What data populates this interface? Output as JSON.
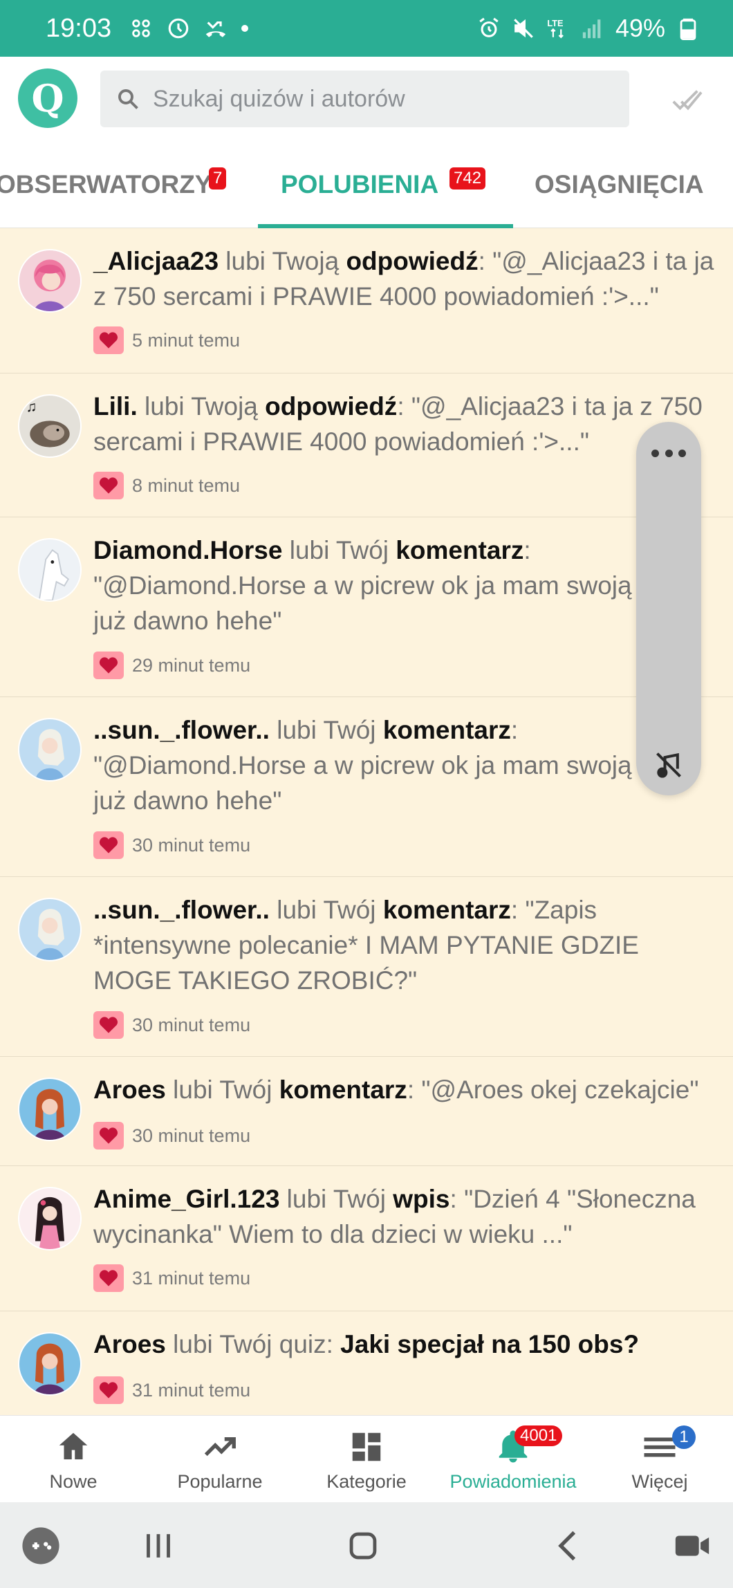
{
  "status_bar": {
    "time": "19:03",
    "battery": "49%",
    "network": "LTE"
  },
  "search": {
    "placeholder": "Szukaj quizów i autorów"
  },
  "logo": {
    "letter": "Q"
  },
  "tabs": [
    {
      "label": "OBSERWATORZY",
      "badge": "7"
    },
    {
      "label": "POLUBIENIA",
      "badge": "742"
    },
    {
      "label": "OSIĄGNIĘCIA",
      "badge": ""
    }
  ],
  "notifications": [
    {
      "user": "_Alicjaa23",
      "action": " lubi Twoją ",
      "object": "odpowiedź",
      "sep": ": ",
      "quote": "\"@_Alicjaa23 i ta ja z 750 sercami i PRAWIE 4000 powiadomień :'>...\"",
      "time": "5 minut temu"
    },
    {
      "user": "Lili.",
      "action": " lubi Twoją ",
      "object": "odpowiedź",
      "sep": ": ",
      "quote": "\"@_Alicjaa23 i ta ja z 750 sercami i PRAWIE 4000 powiadomień :'>...\"",
      "time": "8 minut temu"
    },
    {
      "user": "Diamond.Horse",
      "action": " lubi Twój ",
      "object": "komentarz",
      "sep": ": ",
      "quote": "\"@Diamond.Horse a w picrew ok ja mam swoją ocke już dawno hehe\"",
      "time": "29 minut temu"
    },
    {
      "user": "..sun._.flower..",
      "action": " lubi Twój ",
      "object": "komentarz",
      "sep": ": ",
      "quote": "\"@Diamond.Horse a w picrew ok ja mam swoją ocke już dawno hehe\"",
      "time": "30 minut temu"
    },
    {
      "user": "..sun._.flower..",
      "action": " lubi Twój ",
      "object": "komentarz",
      "sep": ": ",
      "quote": "\"Zapis *intensywne polecanie* I MAM PYTANIE GDZIE MOGE TAKIEGO ZROBIĆ?\"",
      "time": "30 minut temu"
    },
    {
      "user": "Aroes",
      "action": " lubi Twój ",
      "object": "komentarz",
      "sep": ": ",
      "quote": "\"@Aroes okej czekajcie\"",
      "time": "30 minut temu"
    },
    {
      "user": "Anime_Girl.123",
      "action": " lubi Twój ",
      "object": "wpis",
      "sep": ": ",
      "quote": "\"Dzień 4 \"Słoneczna wycinanka\" Wiem to dla dzieci w wieku ...\"",
      "time": "31 minut temu"
    },
    {
      "user": "Aroes",
      "action": " lubi Twój quiz: ",
      "object": "Jaki specjał na 150 obs?",
      "sep": "",
      "quote": "",
      "time": "31 minut temu"
    }
  ],
  "bottom_nav": [
    {
      "label": "Nowe",
      "icon": "home-icon",
      "badge": ""
    },
    {
      "label": "Popularne",
      "icon": "trending-icon",
      "badge": ""
    },
    {
      "label": "Kategorie",
      "icon": "dashboard-icon",
      "badge": ""
    },
    {
      "label": "Powiadomienia",
      "icon": "bell-icon",
      "badge": "4001"
    },
    {
      "label": "Więcej",
      "icon": "menu-icon",
      "badge": "1"
    }
  ],
  "colors": {
    "accent": "#2aae94",
    "badge": "#e8131b",
    "background": "#fdf3dd",
    "heart": "#c5133a"
  }
}
